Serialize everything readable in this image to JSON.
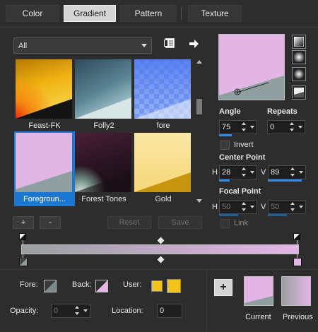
{
  "tabs": [
    {
      "label": "Color"
    },
    {
      "label": "Gradient"
    },
    {
      "label": "Pattern"
    },
    {
      "label": "Texture"
    }
  ],
  "active_tab": "Gradient",
  "category": {
    "selected": "All"
  },
  "gradients": [
    {
      "label": "Feast-FK"
    },
    {
      "label": "Folly2"
    },
    {
      "label": "fore"
    },
    {
      "label": "Foregroun..."
    },
    {
      "label": "Forest Tones"
    },
    {
      "label": "Gold"
    }
  ],
  "selected_gradient": "Foregroun...",
  "list_buttons": {
    "add": "+",
    "remove": "-",
    "reset": "Reset",
    "save": "Save"
  },
  "angle": {
    "label": "Angle",
    "value": "75"
  },
  "repeats": {
    "label": "Repeats",
    "value": "0"
  },
  "invert": {
    "label": "Invert",
    "checked": false
  },
  "center_point": {
    "label": "Center Point",
    "h_label": "H",
    "h": "28",
    "v_label": "V",
    "v": "89"
  },
  "focal_point": {
    "label": "Focal Point",
    "h_label": "H",
    "h": "50",
    "v_label": "V",
    "v": "50"
  },
  "link": {
    "label": "Link",
    "checked": false
  },
  "stop_editor": {
    "fore_label": "Fore:",
    "back_label": "Back:",
    "user_label": "User:",
    "opacity_label": "Opacity:",
    "opacity": "0",
    "location_label": "Location:",
    "location": "0"
  },
  "swatches": {
    "add": "+",
    "current_label": "Current",
    "previous_label": "Previous"
  },
  "colors": {
    "gradient_start": "#9aa0a1",
    "gradient_end": "#e4b5e6",
    "accent": "#1a78d4",
    "user_swatch": "#f2c318",
    "pink": "#e4b5e6",
    "gray": "#8b9c9c"
  },
  "icons": [
    "library-icon",
    "arrow-right-icon",
    "linear-style-icon",
    "rectangular-style-icon",
    "sunburst-style-icon",
    "radial-style-icon"
  ]
}
